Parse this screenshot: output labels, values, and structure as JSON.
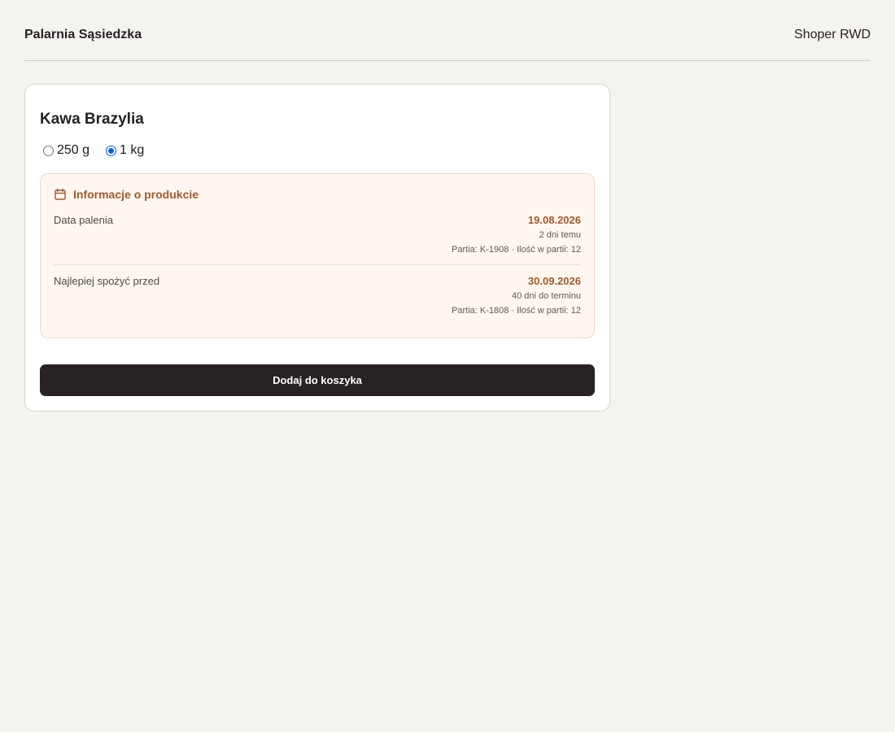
{
  "header": {
    "brand": "Palarnia Sąsiedzka",
    "platform": "Shoper RWD"
  },
  "product": {
    "title": "Kawa Brazylia",
    "variants": [
      {
        "label": "250 g",
        "selected": false
      },
      {
        "label": "1 kg",
        "selected": true
      }
    ],
    "info": {
      "heading": "Informacje o produkcie",
      "icon": "calendar-icon",
      "rows": [
        {
          "label": "Data palenia",
          "date": "19.08.2026",
          "relative": "2 dni temu",
          "batch": "Partia: K-1908 · Ilość w partii: 12"
        },
        {
          "label": "Najlepiej spożyć przed",
          "date": "30.09.2026",
          "relative": "40 dni do terminu",
          "batch": "Partia: K-1808 · Ilość w partii: 12"
        }
      ]
    },
    "add_to_cart_label": "Dodaj do koszyka"
  },
  "colors": {
    "accent": "#9d5a31",
    "button": "#282322",
    "page_background": "#f5f3ef",
    "info_background": "#fff6ef",
    "radio_selected": "#0b63d8"
  }
}
